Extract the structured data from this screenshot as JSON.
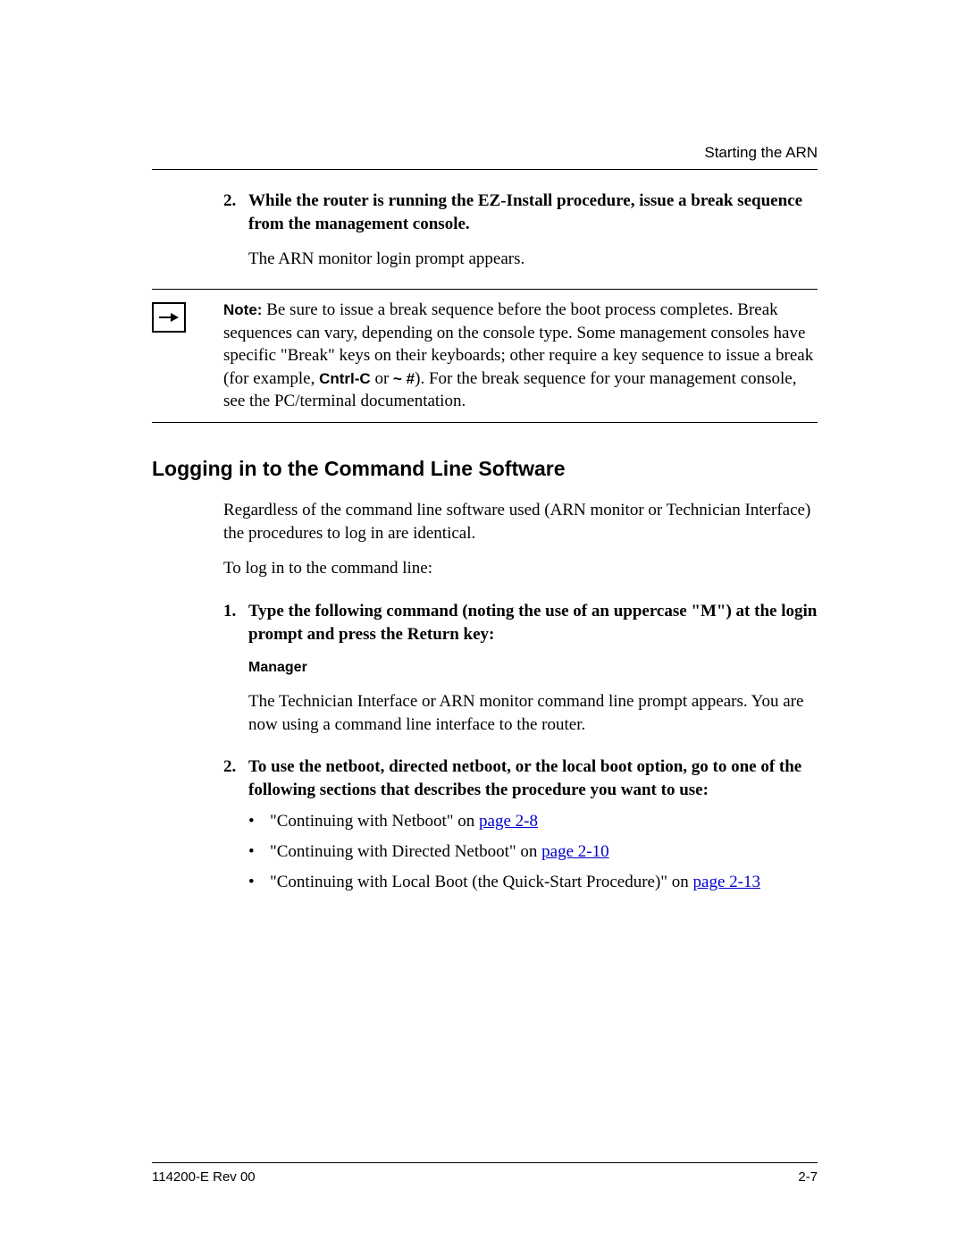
{
  "header": {
    "right": "Starting the ARN"
  },
  "step2": {
    "num": "2.",
    "text": "While the router is running the EZ-Install procedure, issue a break sequence from the management console.",
    "after": "The ARN monitor login prompt appears."
  },
  "note": {
    "label": "Note:",
    "pre": "  Be sure to issue a break sequence before the boot process completes. Break sequences can vary, depending on the console type. Some management consoles have specific \"Break\" keys on their keyboards; other require a key sequence to issue a break (for example, ",
    "kbd1": "Cntrl-C",
    "mid": " or ",
    "kbd2": "~ #",
    "post": "). For the break sequence for your management console, see the PC/terminal documentation."
  },
  "section": {
    "title": "Logging in to the Command Line Software"
  },
  "intro": "Regardless of the command line software used (ARN monitor or Technician Interface) the procedures to log in are identical.",
  "lead": "To log in to the command line:",
  "step1b": {
    "num": "1.",
    "text": "Type the following command (noting the use of an uppercase \"M\") at the login prompt and press the Return key:",
    "manager": "Manager",
    "after": "The Technician Interface or ARN monitor command line prompt appears. You are now using a command line interface to the router."
  },
  "step2b": {
    "num": "2.",
    "text": "To use the netboot, directed netboot, or the local boot option, go to one of the following sections that describes the procedure you want to use:"
  },
  "bullets": [
    {
      "pre": "\"Continuing with Netboot\" on ",
      "link": "page 2-8"
    },
    {
      "pre": "\"Continuing with Directed Netboot\" on ",
      "link": "page 2-10"
    },
    {
      "pre": "\"Continuing with Local Boot (the Quick-Start Procedure)\" on ",
      "link": "page 2-13"
    }
  ],
  "footer": {
    "left": "114200-E Rev 00",
    "right": "2-7"
  }
}
